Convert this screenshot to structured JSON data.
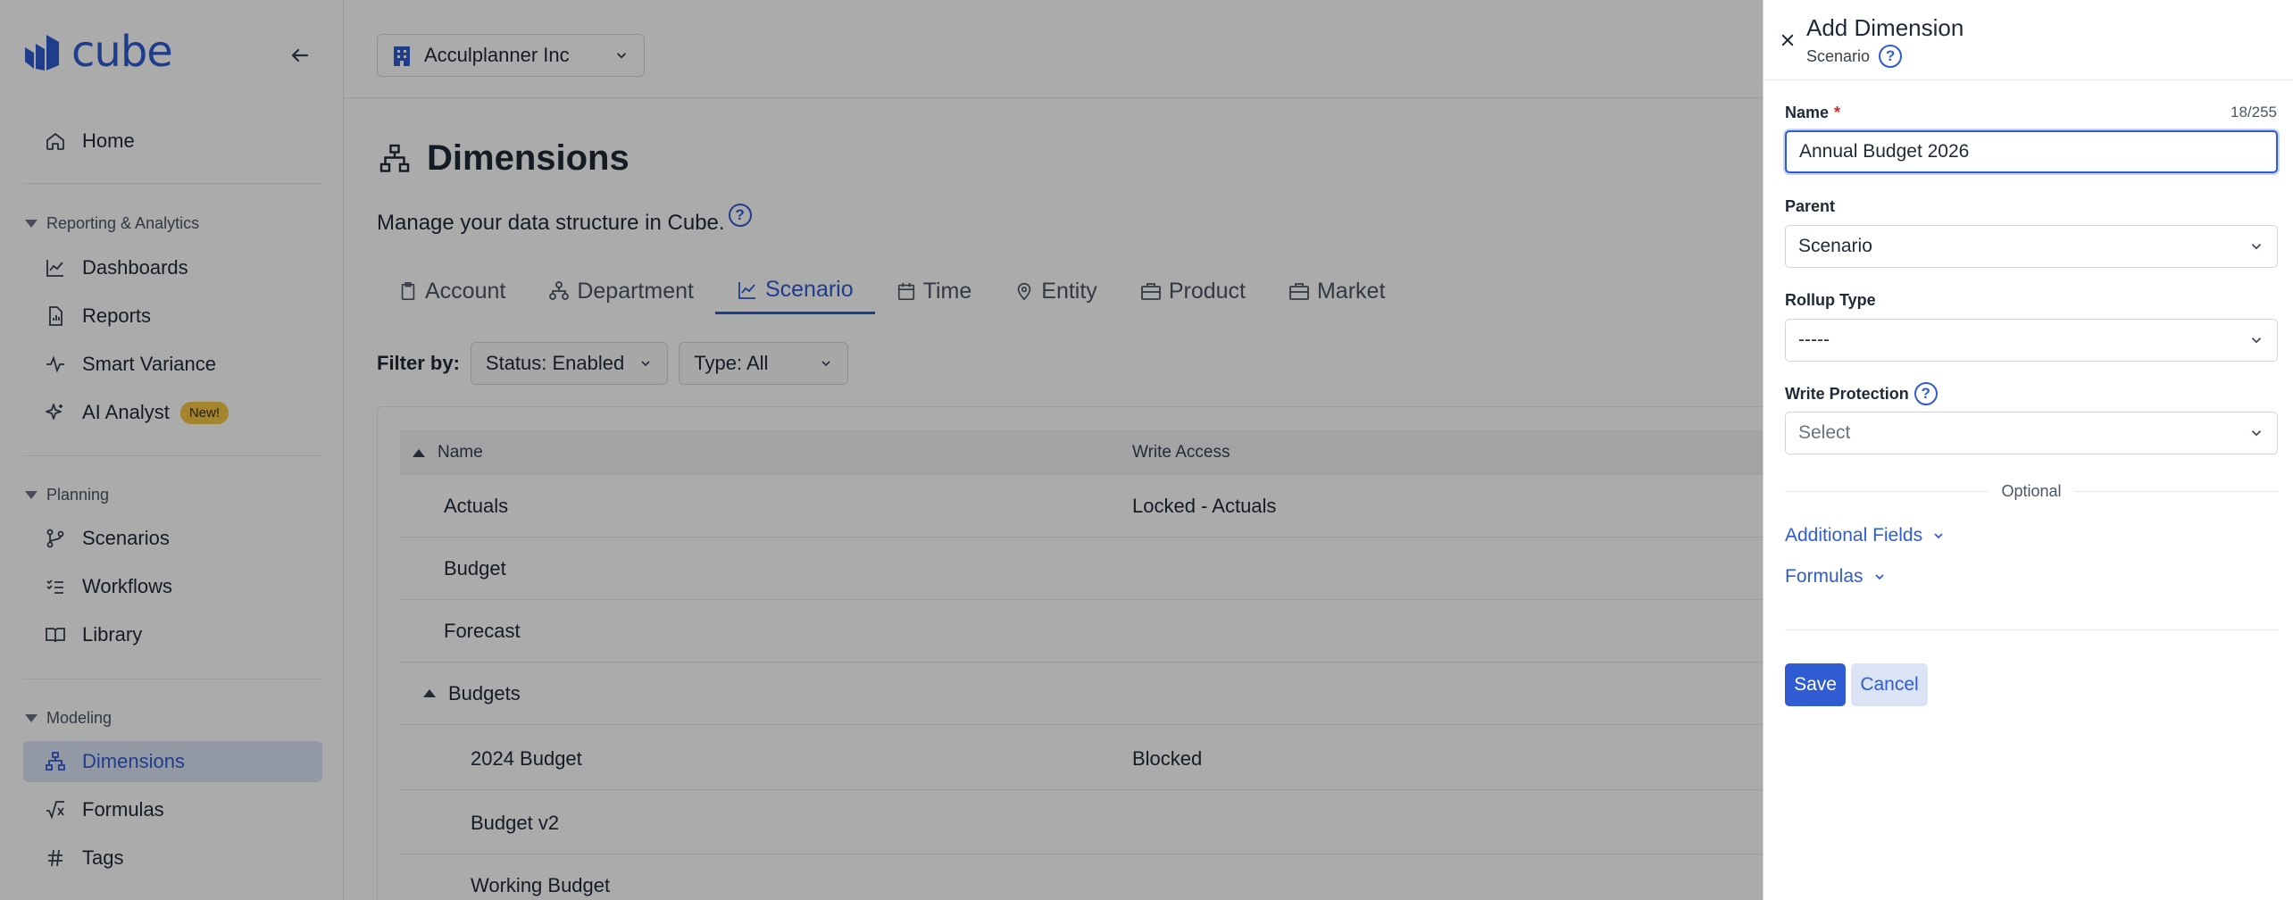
{
  "brand": {
    "name": "cube",
    "color": "#2f5bd3"
  },
  "sidebar": {
    "home": "Home",
    "sections": [
      {
        "title": "Reporting & Analytics",
        "items": [
          "Dashboards",
          "Reports",
          "Smart Variance",
          "AI Analyst"
        ]
      },
      {
        "title": "Planning",
        "items": [
          "Scenarios",
          "Workflows",
          "Library"
        ]
      },
      {
        "title": "Modeling",
        "items": [
          "Dimensions",
          "Formulas",
          "Tags"
        ]
      }
    ],
    "new_badge": "New!"
  },
  "org": {
    "name": "Acculplanner Inc"
  },
  "page": {
    "title": "Dimensions",
    "subtitle": "Manage your data structure in Cube."
  },
  "tabs": [
    "Account",
    "Department",
    "Scenario",
    "Time",
    "Entity",
    "Product",
    "Market"
  ],
  "filters": {
    "label": "Filter by:",
    "status": "Status: Enabled",
    "type": "Type: All"
  },
  "table": {
    "columns": [
      "Name",
      "Write Access"
    ],
    "rows": [
      {
        "name": "Actuals",
        "access": "Locked - Actuals"
      },
      {
        "name": "Budget",
        "access": ""
      },
      {
        "name": "Forecast",
        "access": ""
      },
      {
        "name": "Budgets",
        "access": ""
      },
      {
        "name": "2024 Budget",
        "access": "Blocked"
      },
      {
        "name": "Budget v2",
        "access": ""
      },
      {
        "name": "Working Budget",
        "access": ""
      }
    ]
  },
  "drawer": {
    "title": "Add Dimension",
    "subtitle": "Scenario",
    "name_label": "Name",
    "name_counter": "18/255",
    "name_value": "Annual Budget 2026",
    "parent_label": "Parent",
    "parent_value": "Scenario",
    "rollup_label": "Rollup Type",
    "rollup_value": "-----",
    "write_label": "Write Protection",
    "write_placeholder": "Select",
    "optional": "Optional",
    "additional_fields": "Additional Fields",
    "formulas": "Formulas",
    "save": "Save",
    "cancel": "Cancel"
  }
}
